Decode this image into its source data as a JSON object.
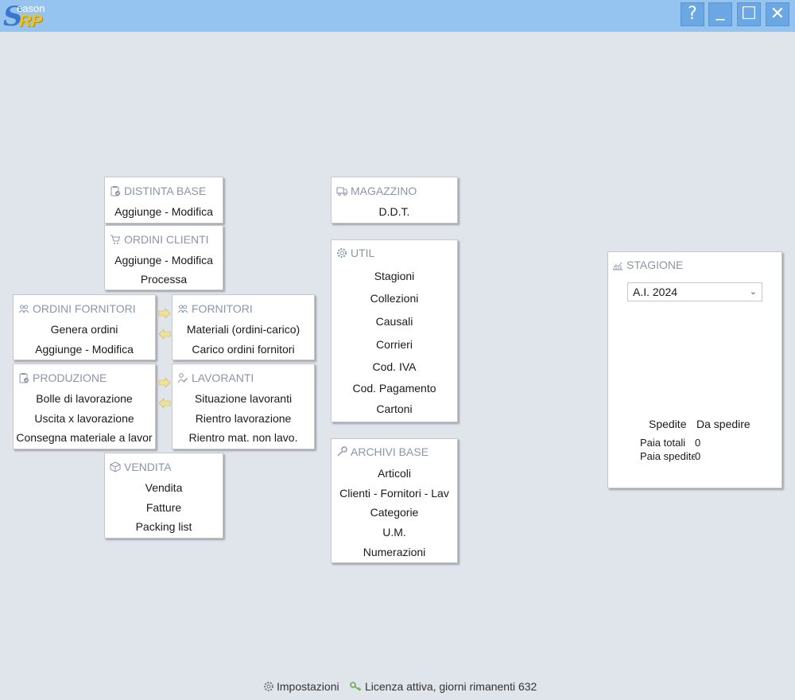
{
  "app": {
    "logo": {
      "s": "S",
      "eason": "eason",
      "rp": "RP"
    },
    "window_buttons": {
      "help": "?",
      "minimize": "_",
      "maximize": "☐",
      "close": "✕"
    }
  },
  "modules": {
    "distinta_base": {
      "title": "DISTINTA BASE",
      "items": [
        "Aggiunge - Modifica"
      ]
    },
    "ordini_clienti": {
      "title": "ORDINI CLIENTI",
      "items": [
        "Aggiunge - Modifica",
        "Processa"
      ]
    },
    "ordini_fornitori": {
      "title": "ORDINI FORNITORI",
      "items": [
        "Genera ordini",
        "Aggiunge - Modifica"
      ]
    },
    "fornitori": {
      "title": "FORNITORI",
      "items": [
        "Materiali (ordini-carico)",
        "Carico ordini fornitori"
      ]
    },
    "produzione": {
      "title": "PRODUZIONE",
      "items": [
        "Bolle di lavorazione",
        "Uscita x lavorazione",
        "Consegna materiale a lavor"
      ]
    },
    "lavoranti": {
      "title": "LAVORANTI",
      "items": [
        "Situazione lavoranti",
        "Rientro lavorazione",
        "Rientro mat. non lavo."
      ]
    },
    "vendita": {
      "title": "VENDITA",
      "items": [
        "Vendita",
        "Fatture",
        "Packing list"
      ]
    },
    "magazzino": {
      "title": "MAGAZZINO",
      "items": [
        "D.D.T."
      ]
    },
    "util": {
      "title": "UTIL",
      "items": [
        "Stagioni",
        "Collezioni",
        "Causali",
        "Corrieri",
        "Cod. IVA",
        "Cod. Pagamento",
        "Cartoni"
      ]
    },
    "archivi_base": {
      "title": "ARCHIVI BASE",
      "items": [
        "Articoli",
        "Clienti - Fornitori - Lav",
        "Categorie",
        "U.M.",
        "Numerazioni"
      ]
    }
  },
  "stagione": {
    "title": "STAGIONE",
    "selected": "A.I. 2024",
    "col_spedite": "Spedite",
    "col_da_spedire": "Da spedire",
    "paia_totali_label": "Paia totali",
    "paia_totali_value": "0",
    "paia_spedite_label": "Paia spedite",
    "paia_spedite_value": "0"
  },
  "footer": {
    "impostazioni": "Impostazioni",
    "licenza": "Licenza attiva, giorni rimanenti 632"
  },
  "colors": {
    "titlebar": "#95c4f1",
    "background": "#e0e4eb",
    "header_text": "#8b95a8",
    "arrow": "#efe19a"
  }
}
